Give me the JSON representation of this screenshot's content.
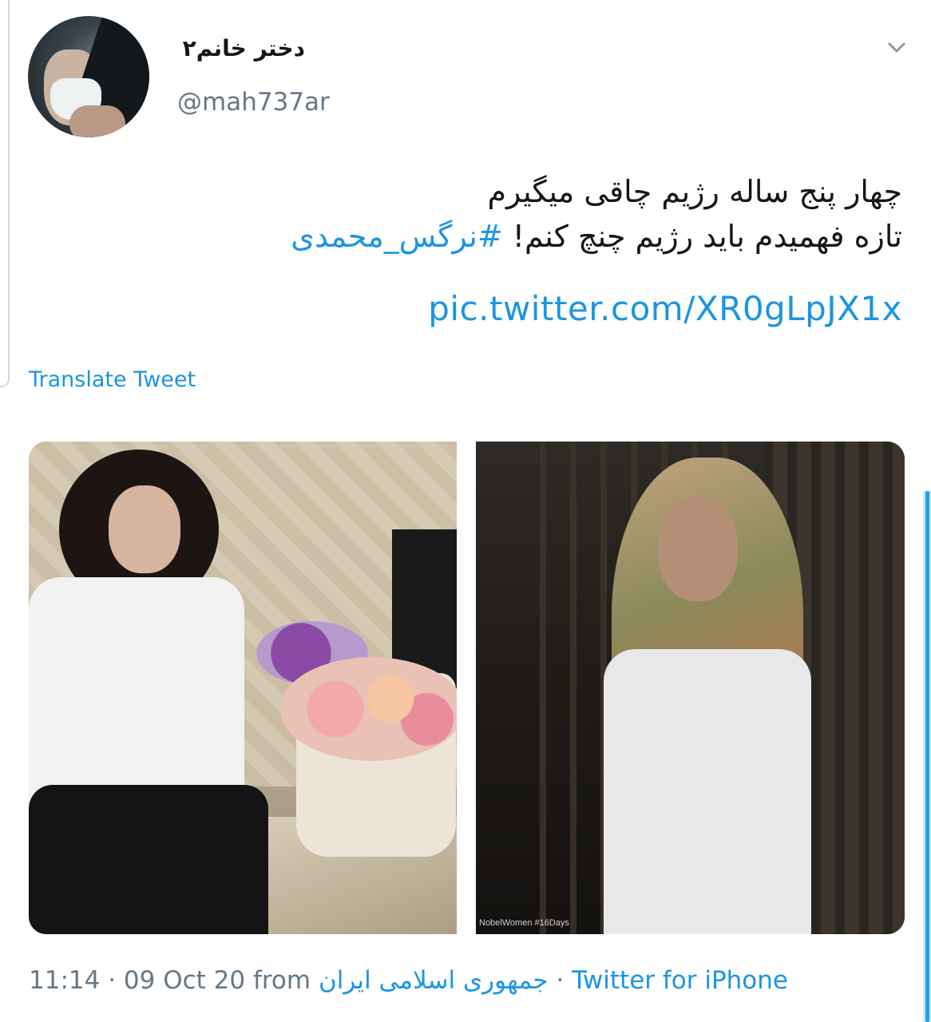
{
  "author": {
    "display_name": "دختر خانم۲",
    "handle": "@mah737ar"
  },
  "icons": {
    "menu": "chevron-down-icon",
    "avatar": "avatar"
  },
  "tweet": {
    "line1": "چهار  پنج ساله رژیم چاقی میگیرم",
    "line2_text": "تازه فهمیدم باید رژیم چنچ کنم! ",
    "line2_hashtag": "#نرگس_محمدی",
    "link": "pic.twitter.com/XR0gLpJX1x",
    "translate_label": "Translate Tweet"
  },
  "media": {
    "right_caption": "NobelWomen  #16Days"
  },
  "meta": {
    "time_date": "11:14 · 09 Oct 20 from ",
    "place": "جمهوری اسلامی ایران",
    "separator": " · ",
    "source": "Twitter for iPhone"
  },
  "colors": {
    "link": "#1b95e0",
    "muted": "#657786",
    "text": "#14171a"
  }
}
